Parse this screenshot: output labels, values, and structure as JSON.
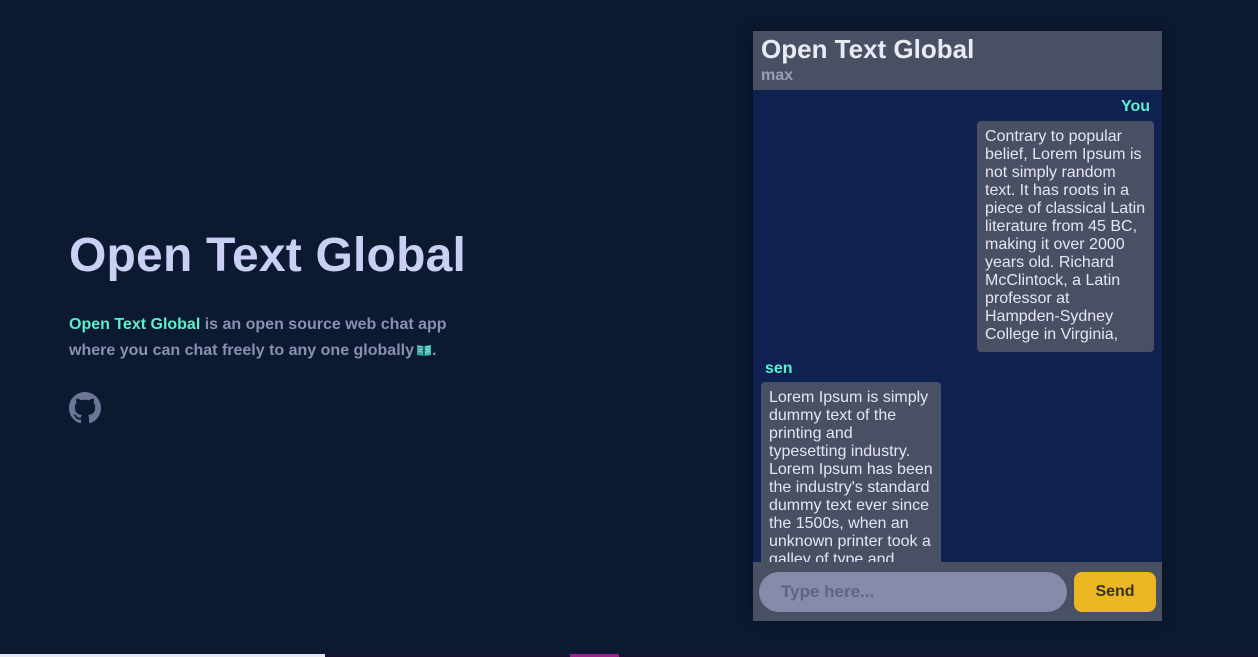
{
  "hero": {
    "title": "Open Text Global",
    "brand": "Open Text Global",
    "description": " is an open source web chat app where you can chat freely to any one globally",
    "description_end": ".",
    "github_icon": "github-icon",
    "book_icon": "open-book-icon"
  },
  "chat": {
    "title": "Open Text Global",
    "current_user": "max",
    "messages": [
      {
        "sender": "You",
        "text": "Contrary to popular belief, Lorem Ipsum is not simply random text. It has roots in a piece of classical Latin literature from 45 BC, making it over 2000 years old. Richard McClintock, a Latin professor at Hampden-Sydney College in Virginia,"
      },
      {
        "sender": "sen",
        "text": "Lorem Ipsum is simply dummy text of the printing and typesetting industry. Lorem Ipsum has been the industry's standard dummy text ever since the 1500s, when an unknown printer took a galley of type and"
      }
    ],
    "input_placeholder": "Type here...",
    "input_value": "",
    "send_label": "Send"
  },
  "colors": {
    "background": "#0b1931",
    "accent": "#5ef0cc",
    "panel": "#4a5063",
    "chat_bg": "#0f2150",
    "send_button": "#eab723"
  }
}
